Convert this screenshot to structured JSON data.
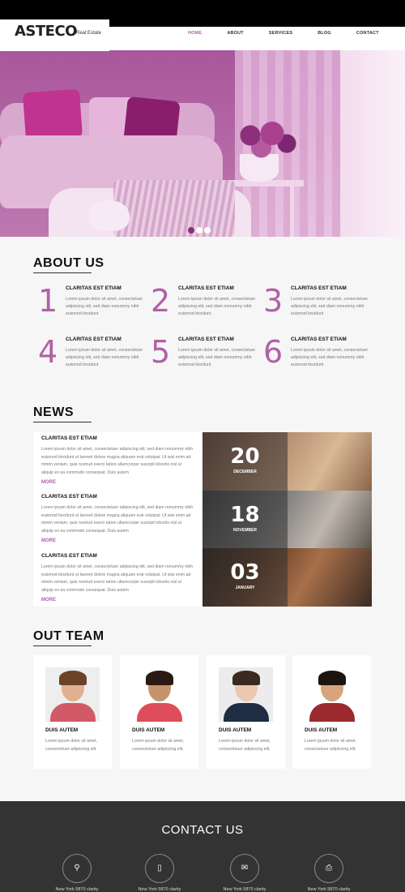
{
  "header": {
    "logo": "ASTECO",
    "logo_sub": "Real Estate",
    "nav": [
      "HOME",
      "ABOUT",
      "SERVICES",
      "BLOG",
      "CONTACT"
    ],
    "nav_active": "HOME"
  },
  "hero": {
    "slides_count": 3,
    "active_slide": 1
  },
  "about": {
    "title": "ABOUT US",
    "items": [
      {
        "num": "1",
        "head": "CLARITAS EST ETIAM",
        "text": "Lorem ipsum dolor sit amet, consectetuer adipiscing elit, sed diam nonummy nibh euismod tincidunt"
      },
      {
        "num": "2",
        "head": "CLARITAS EST ETIAM",
        "text": "Lorem ipsum dolor sit amet, consectetuer adipiscing elit, sed diam nonummy nibh euismod tincidunt"
      },
      {
        "num": "3",
        "head": "CLARITAS EST ETIAM",
        "text": "Lorem ipsum dolor sit amet, consectetuer adipiscing elit, sed diam nonummy nibh euismod tincidunt"
      },
      {
        "num": "4",
        "head": "CLARITAS EST ETIAM",
        "text": "Lorem ipsum dolor sit amet, consectetuer adipiscing elit, sed diam nonummy nibh euismod tincidunt"
      },
      {
        "num": "5",
        "head": "CLARITAS EST ETIAM",
        "text": "Lorem ipsum dolor sit amet, consectetuer adipiscing elit, sed diam nonummy nibh euismod tincidunt"
      },
      {
        "num": "6",
        "head": "CLARITAS EST ETIAM",
        "text": "Lorem ipsum dolor sit amet, consectetuer adipiscing elit, sed diam nonummy nibh euismod tincidunt"
      }
    ]
  },
  "news": {
    "title": "NEWS",
    "entries": [
      {
        "head": "CLARITAS EST ETIAM",
        "text": "Lorem ipsum dolor sit amet, consectetuer adipiscing elit, sed diam nonummy nibh euismod tincidunt ut laoreet dolore magna aliquam erat volutpat. Ut wisi enim ad minim veniam, quis nostrud exerci tation ullamcorper suscipit lobortis nisl ut aliquip ex ea commodo consequat. Duis autem",
        "more": "MORE"
      },
      {
        "head": "CLARITAS EST ETIAM",
        "text": "Lorem ipsum dolor sit amet, consectetuer adipiscing elit, sed diam nonummy nibh euismod tincidunt ut laoreet dolore magna aliquam erat volutpat. Ut wisi enim ad minim veniam, quis nostrud exerci tation ullamcorper suscipit lobortis nisl ut aliquip ex ea commodo consequat. Duis autem",
        "more": "MORE"
      },
      {
        "head": "CLARITAS EST ETIAM",
        "text": "Lorem ipsum dolor sit amet, consectetuer adipiscing elit, sed diam nonummy nibh euismod tincidunt ut laoreet dolore magna aliquam erat volutpat. Ut wisi enim ad minim veniam, quis nostrud exerci tation ullamcorper suscipit lobortis nisl ut aliquip ex ea commodo consequat. Duis autem",
        "more": "MORE"
      }
    ],
    "dates": [
      {
        "day": "20",
        "month": "DECEMBER"
      },
      {
        "day": "18",
        "month": "NOVEMBER"
      },
      {
        "day": "03",
        "month": "JANUARY"
      }
    ]
  },
  "team": {
    "title": "OUT TEAM",
    "members": [
      {
        "name": "DUIS AUTEM",
        "text": "Lorem ipsum dolor sit amet, consectetuer adipiscing elit."
      },
      {
        "name": "DUIS AUTEM",
        "text": "Lorem ipsum dolor sit amet, consectetuer adipiscing elit."
      },
      {
        "name": "DUIS AUTEM",
        "text": "Lorem ipsum dolor sit amet, consectetuer adipiscing elit."
      },
      {
        "name": "DUIS AUTEM",
        "text": "Lorem ipsum dolor sit amet, consectetuer adipiscing elit."
      }
    ]
  },
  "contact": {
    "title": "CONTACT US",
    "items": [
      {
        "icon": "map-pin-icon",
        "glyph": "⚲",
        "text": "New York 5870 clarity"
      },
      {
        "icon": "phone-icon",
        "glyph": "▯",
        "text": "New York 5870 clarity"
      },
      {
        "icon": "mail-icon",
        "glyph": "✉",
        "text": "New York 5870 clarity"
      },
      {
        "icon": "printer-icon",
        "glyph": "⎙",
        "text": "New York 5870 clarity"
      }
    ]
  },
  "colors": {
    "accent": "#b061a6",
    "footer_bg": "#333333"
  }
}
